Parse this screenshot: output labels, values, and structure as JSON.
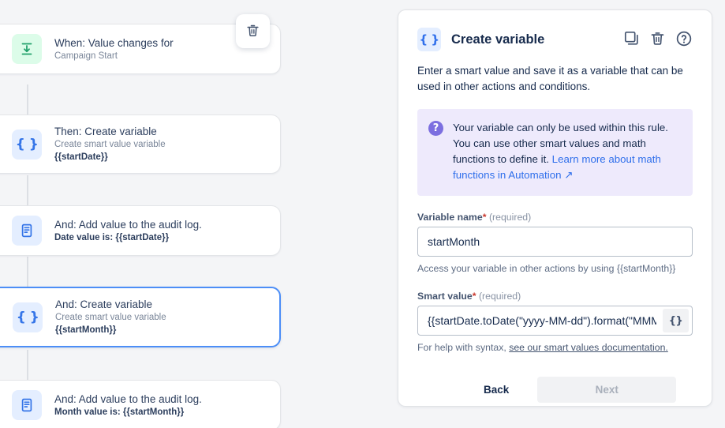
{
  "rule_canvas": {
    "delete_button_label": "Delete rule component",
    "delete_icon": "trash-icon",
    "cards": [
      {
        "title": "When: Value changes for",
        "subtitle": "Campaign Start",
        "subtitle_strong": "",
        "icon": "value-changes-icon",
        "icon_color": "green",
        "selected": false
      },
      {
        "title": "Then: Create variable",
        "subtitle": "Create smart value variable",
        "subtitle_strong": "{{startDate}}",
        "icon": "braces-icon",
        "icon_color": "blue",
        "selected": false
      },
      {
        "title": "And: Add value to the audit log.",
        "subtitle": "",
        "subtitle_strong": "Date value is: {{startDate}}",
        "icon": "audit-log-icon",
        "icon_color": "blue",
        "selected": false
      },
      {
        "title": "And: Create variable",
        "subtitle": "Create smart value variable",
        "subtitle_strong": "{{startMonth}}",
        "icon": "braces-icon",
        "icon_color": "blue",
        "selected": true
      },
      {
        "title": "And: Add value to the audit log.",
        "subtitle": "",
        "subtitle_strong": "Month value is: {{startMonth}}",
        "icon": "audit-log-icon",
        "icon_color": "blue",
        "selected": false
      }
    ]
  },
  "detail_panel": {
    "icon": "braces-icon",
    "title": "Create variable",
    "description": "Enter a smart value and save it as a variable that can be used in other actions and conditions.",
    "actions": [
      {
        "name": "duplicate-button",
        "icon": "copy-icon",
        "label": "Duplicate"
      },
      {
        "name": "delete-button",
        "icon": "trash-icon",
        "label": "Delete"
      },
      {
        "name": "help-button",
        "icon": "question-circle-icon",
        "label": "Help"
      }
    ],
    "info_callout": {
      "icon": "question-circle-icon",
      "text": "Your variable can only be used within this rule. You can use other smart values and math functions to define it. ",
      "link_text": "Learn more about math functions in Automation",
      "link_suffix": "↗"
    },
    "fields": {
      "variable_name": {
        "label": "Variable name",
        "required_star": "*",
        "required_note": "(required)",
        "value": "startMonth",
        "placeholder": "",
        "help": "Access your variable in other actions by using {{startMonth}}"
      },
      "smart_value": {
        "label": "Smart value",
        "required_star": "*",
        "required_note": "(required)",
        "value": "{{startDate.toDate(\"yyyy-MM-dd\").format(\"MMM\")}}",
        "placeholder": "",
        "picker_button_label": "{}",
        "help_prefix": "For help with syntax, ",
        "help_link": "see our smart values documentation."
      }
    },
    "footer": {
      "back_label": "Back",
      "next_label": "Next"
    }
  },
  "colors": {
    "page_background": "#f4f5f7",
    "card_background": "#ffffff",
    "selected_border": "#4c8ef7",
    "accent_blue": "#2f6feb",
    "callout_background": "#eeeafc",
    "callout_icon": "#7c6fe0",
    "trigger_icon_background": "#dcfce9",
    "trigger_icon_color": "#22a06b",
    "action_icon_background": "#e4eeff",
    "required_star": "#c9372c"
  }
}
